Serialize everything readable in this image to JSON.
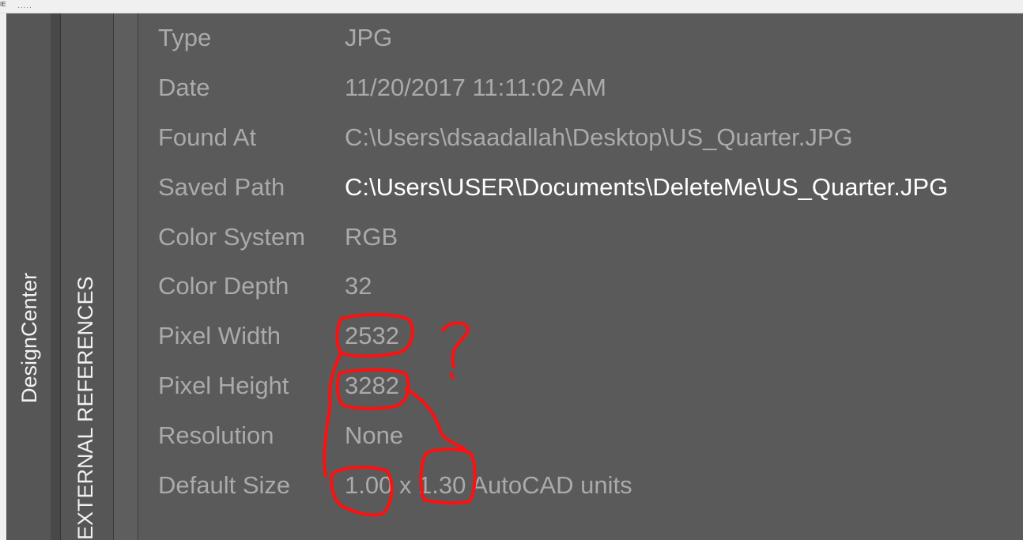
{
  "window": {
    "corner_label": "IE",
    "grip": "....."
  },
  "side_tabs": {
    "design_center": "DesignCenter",
    "external_references": "EXTERNAL REFERENCES"
  },
  "properties": [
    {
      "label": "Type",
      "value": "JPG"
    },
    {
      "label": "Date",
      "value": "11/20/2017 11:11:02 AM"
    },
    {
      "label": "Found At",
      "value": "C:\\Users\\dsaadallah\\Desktop\\US_Quarter.JPG"
    },
    {
      "label": "Saved Path",
      "value": "C:\\Users\\USER\\Documents\\DeleteMe\\US_Quarter.JPG"
    },
    {
      "label": "Color System",
      "value": "RGB"
    },
    {
      "label": "Color Depth",
      "value": "32"
    },
    {
      "label": "Pixel Width",
      "value": "2532"
    },
    {
      "label": "Pixel Height",
      "value": "3282"
    },
    {
      "label": "Resolution",
      "value": "None"
    },
    {
      "label": "Default Size",
      "value": "1.00 x 1.30 AutoCAD units"
    }
  ],
  "annotation": {
    "mark": "?",
    "color": "#ff1010"
  }
}
